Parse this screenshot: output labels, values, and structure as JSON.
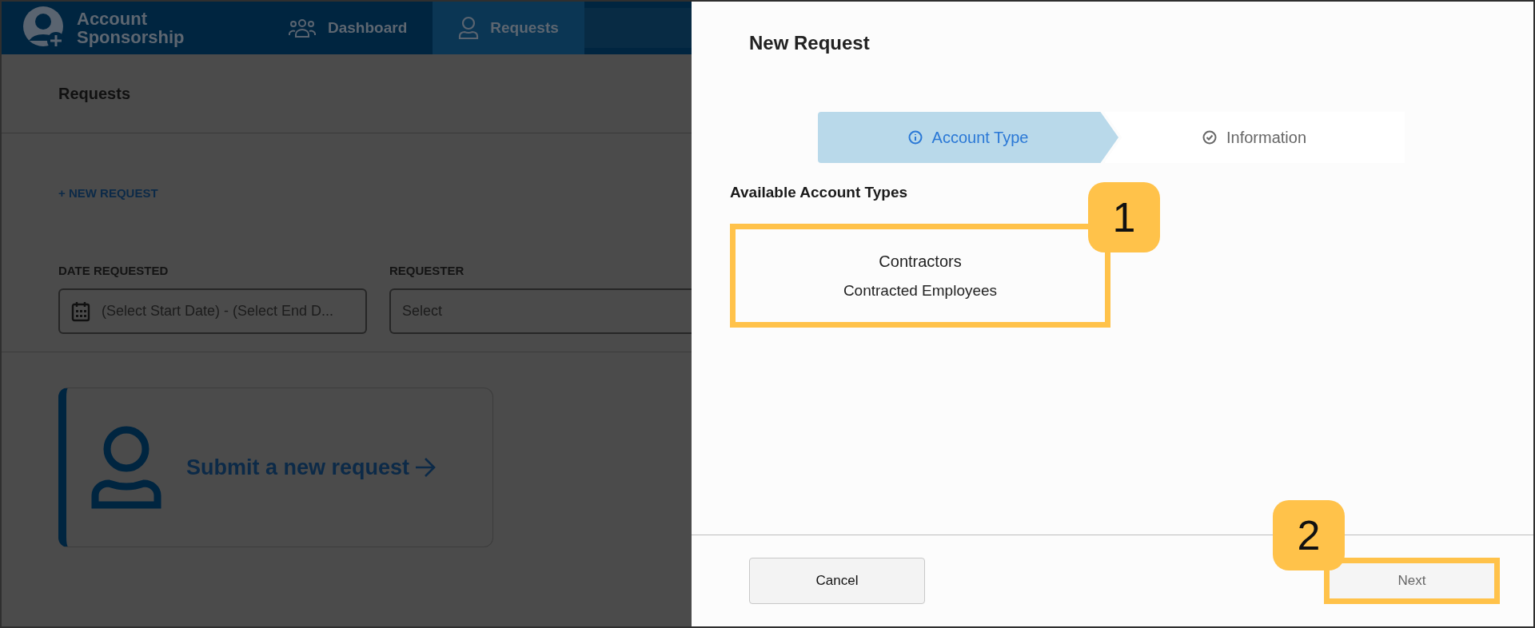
{
  "app": {
    "title": "Account Sponsorship",
    "nav": [
      {
        "label": "Dashboard",
        "selected": false
      },
      {
        "label": "Requests",
        "selected": true
      }
    ]
  },
  "page": {
    "title": "Requests",
    "new_request_link": "+ NEW REQUEST",
    "filters": [
      {
        "label": "DATE REQUESTED",
        "kind": "date",
        "value": "(Select Start Date) - (Select End D..."
      },
      {
        "label": "REQUESTER",
        "kind": "select",
        "value": "Select"
      }
    ],
    "cta": "Submit a new request"
  },
  "dialog": {
    "title": "New Request",
    "steps": [
      {
        "label": "Account Type",
        "selected": true
      },
      {
        "label": "Information",
        "selected": false
      }
    ],
    "section_title": "Available Account Types",
    "account_types": [
      {
        "name": "Contractors",
        "description": "Contracted Employees",
        "callout": "1"
      }
    ],
    "buttons": [
      {
        "label": "Cancel",
        "kind": "secondary"
      },
      {
        "label": "Next",
        "kind": "primary",
        "callout": "2"
      }
    ]
  }
}
